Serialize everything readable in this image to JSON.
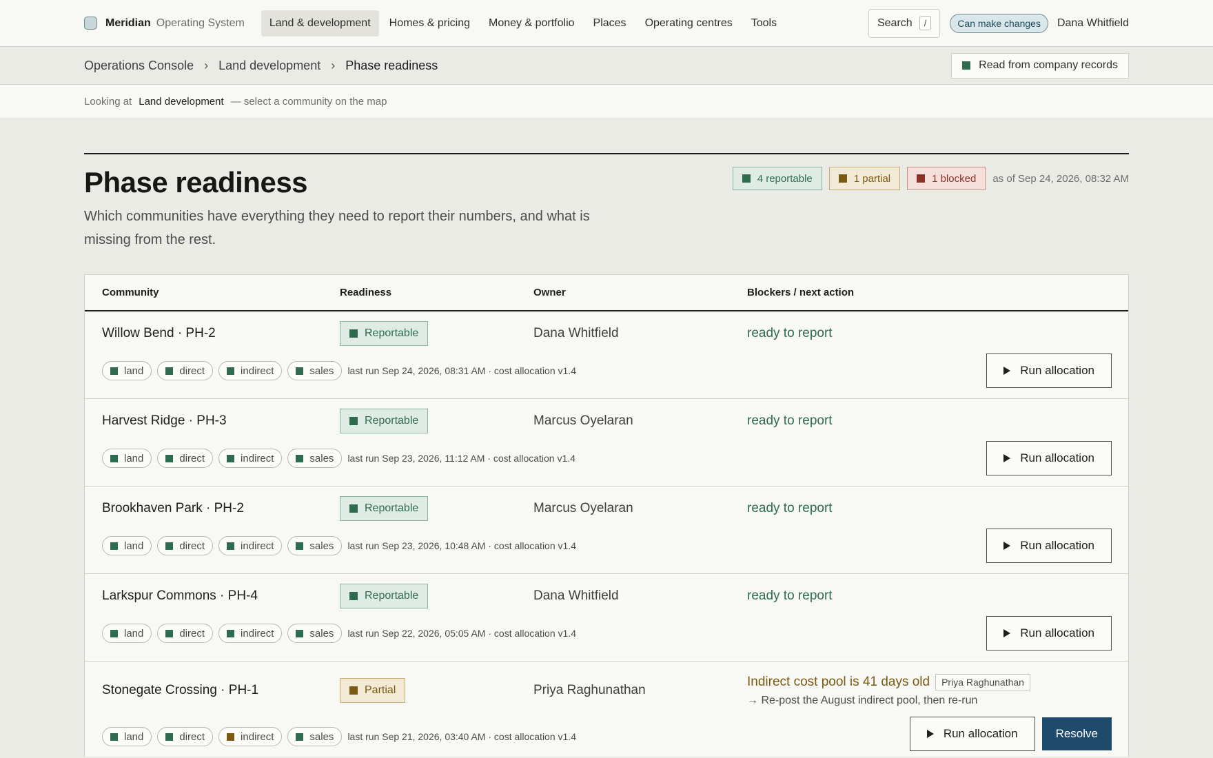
{
  "topnav": {
    "brand": "Meridian",
    "brand_sub": "Operating System",
    "items": [
      "Land & development",
      "Homes & pricing",
      "Money & portfolio",
      "Places",
      "Operating centres",
      "Tools"
    ],
    "search_label": "Search",
    "search_shortcut": "/",
    "permission": "Can make changes",
    "user": "Dana Whitfield"
  },
  "breadcrumb": {
    "items": [
      "Operations Console",
      "Land development",
      "Phase readiness"
    ],
    "records_label": "Read from company records"
  },
  "context": {
    "prefix": "Looking at",
    "value": "Land development",
    "suffix": "— select a community on the map"
  },
  "page": {
    "title": "Phase readiness",
    "description": "Which communities have everything they need to report their numbers, and what is missing from the rest.",
    "summary": {
      "reportable": "4 reportable",
      "partial": "1 partial",
      "blocked": "1 blocked",
      "as_of": "as of Sep 24, 2026, 08:32 AM"
    }
  },
  "table": {
    "headers": [
      "Community",
      "Readiness",
      "Owner",
      "Blockers / next action"
    ],
    "run_label": "Run allocation",
    "resolve_label": "Resolve",
    "rows": [
      {
        "community": "Willow Bend · PH-2",
        "readiness": "Reportable",
        "owner": "Dana Whitfield",
        "action": "ready to report",
        "chips": [
          "land",
          "direct",
          "indirect",
          "sales"
        ],
        "meta": "last run Sep 24, 2026, 08:31 AM · cost allocation v1.4"
      },
      {
        "community": "Harvest Ridge · PH-3",
        "readiness": "Reportable",
        "owner": "Marcus Oyelaran",
        "action": "ready to report",
        "chips": [
          "land",
          "direct",
          "indirect",
          "sales"
        ],
        "meta": "last run Sep 23, 2026, 11:12 AM · cost allocation v1.4"
      },
      {
        "community": "Brookhaven Park · PH-2",
        "readiness": "Reportable",
        "owner": "Marcus Oyelaran",
        "action": "ready to report",
        "chips": [
          "land",
          "direct",
          "indirect",
          "sales"
        ],
        "meta": "last run Sep 23, 2026, 10:48 AM · cost allocation v1.4"
      },
      {
        "community": "Larkspur Commons · PH-4",
        "readiness": "Reportable",
        "owner": "Dana Whitfield",
        "action": "ready to report",
        "chips": [
          "land",
          "direct",
          "indirect",
          "sales"
        ],
        "meta": "last run Sep 22, 2026, 05:05 AM · cost allocation v1.4"
      },
      {
        "community": "Stonegate Crossing · PH-1",
        "readiness": "Partial",
        "owner": "Priya Raghunathan",
        "blocker": "Indirect cost pool is 41 days old",
        "blocker_assignee": "Priya Raghunathan",
        "next_step": "→ Re-post the August indirect pool, then re-run",
        "chips": [
          "land",
          "direct",
          "indirect",
          "sales"
        ],
        "meta": "last run Sep 21, 2026, 03:40 AM · cost allocation v1.4"
      }
    ]
  },
  "colors": {
    "reportable": "#2f6b4f",
    "partial": "#7a5a12",
    "blocked": "#8a3328",
    "primary": "#1e4a6b"
  }
}
